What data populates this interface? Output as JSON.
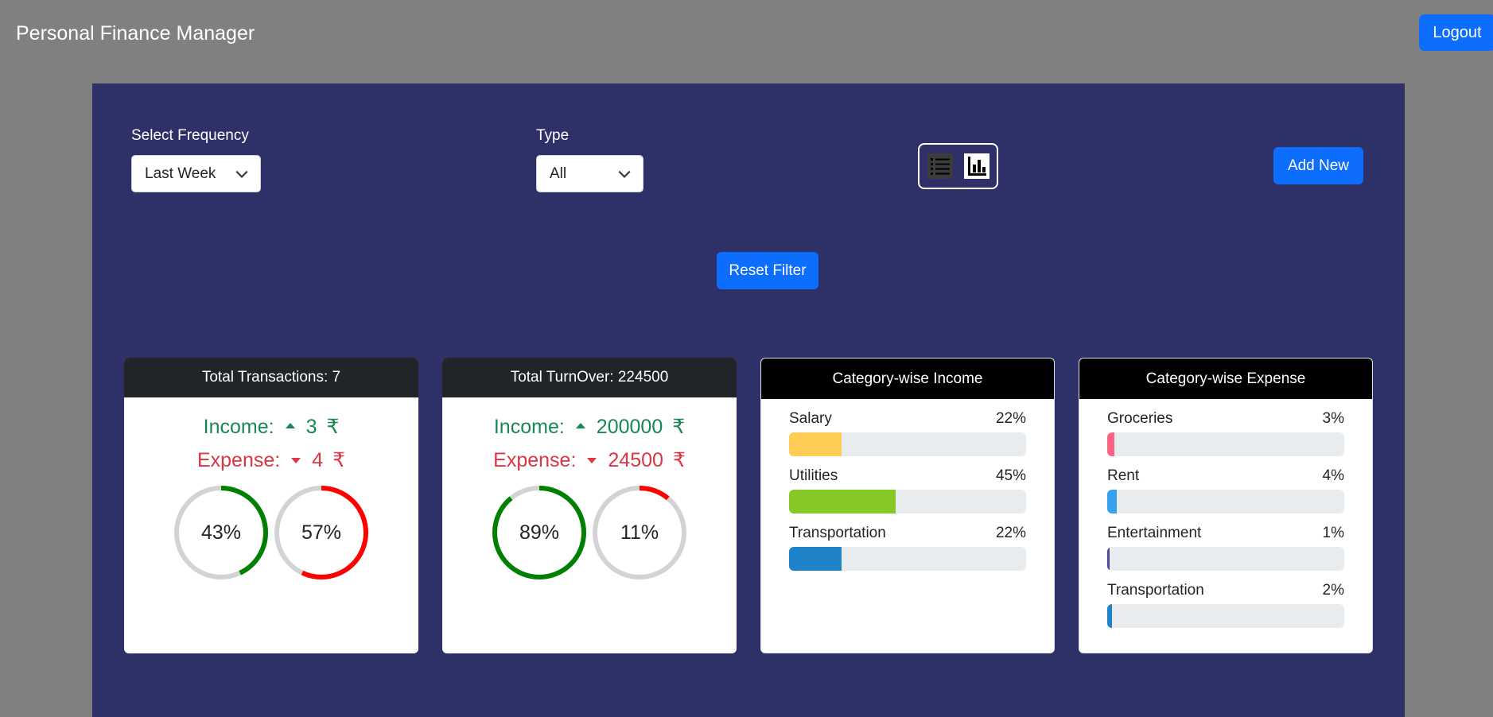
{
  "app": {
    "title": "Personal Finance Manager",
    "logout_label": "Logout"
  },
  "filters": {
    "frequency": {
      "label": "Select Frequency",
      "value": "Last Week"
    },
    "type": {
      "label": "Type",
      "value": "All"
    },
    "add_new_label": "Add New",
    "reset_label": "Reset Filter"
  },
  "view_toggle": {
    "list_icon": "list-icon",
    "chart_icon": "bar-chart-icon"
  },
  "transactions_card": {
    "title": "Total Transactions: 7",
    "income": {
      "label": "Income:",
      "value": "3",
      "currency": "₹"
    },
    "expense": {
      "label": "Expense:",
      "value": "4",
      "currency": "₹"
    },
    "income_pct": 43,
    "expense_pct": 57,
    "income_pct_label": "43%",
    "expense_pct_label": "57%"
  },
  "turnover_card": {
    "title": "Total TurnOver: 224500",
    "income": {
      "label": "Income:",
      "value": "200000",
      "currency": "₹"
    },
    "expense": {
      "label": "Expense:",
      "value": "24500",
      "currency": "₹"
    },
    "income_pct": 89,
    "expense_pct": 11,
    "income_pct_label": "89%",
    "expense_pct_label": "11%"
  },
  "income_categories": {
    "title": "Category-wise Income",
    "items": [
      {
        "name": "Salary",
        "pct": 22,
        "pct_label": "22%",
        "color": "#ffcd56"
      },
      {
        "name": "Utilities",
        "pct": 45,
        "pct_label": "45%",
        "color": "#86c926"
      },
      {
        "name": "Transportation",
        "pct": 22,
        "pct_label": "22%",
        "color": "#1e83c8"
      }
    ]
  },
  "expense_categories": {
    "title": "Category-wise Expense",
    "items": [
      {
        "name": "Groceries",
        "pct": 3,
        "pct_label": "3%",
        "color": "#ff6384"
      },
      {
        "name": "Rent",
        "pct": 4,
        "pct_label": "4%",
        "color": "#36a2eb"
      },
      {
        "name": "Entertainment",
        "pct": 1,
        "pct_label": "1%",
        "color": "#4b4b9a"
      },
      {
        "name": "Transportation",
        "pct": 2,
        "pct_label": "2%",
        "color": "#1e83c8"
      }
    ]
  },
  "colors": {
    "income": "#198754",
    "expense": "#dc3545",
    "ring_income": "#008000",
    "ring_expense": "#ff0000",
    "ring_track": "#d3d3d3",
    "panel": "#2e3168",
    "primary": "#0d6efd"
  }
}
